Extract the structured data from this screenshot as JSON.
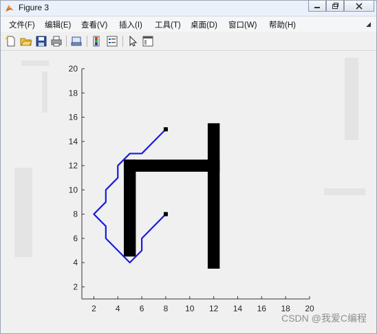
{
  "window": {
    "title": "Figure 3"
  },
  "menu": {
    "items": [
      {
        "label": "文件(F)"
      },
      {
        "label": "编辑(E)"
      },
      {
        "label": "查看(V)"
      },
      {
        "label": "插入(I)"
      },
      {
        "label": "工具(T)"
      },
      {
        "label": "桌面(D)"
      },
      {
        "label": "窗口(W)"
      },
      {
        "label": "帮助(H)"
      }
    ]
  },
  "toolbar": {
    "icons": [
      "new-figure-icon",
      "open-file-icon",
      "save-icon",
      "print-icon",
      "print-preview-icon",
      "insert-colorbar-icon",
      "insert-legend-icon",
      "edit-plot-pointer-icon",
      "property-inspector-icon"
    ]
  },
  "colors": {
    "path_line": "#1a1adc",
    "obstacle": "#000000",
    "axis": "#333333",
    "plot_bg": "#f0f0f0"
  },
  "chart_data": {
    "type": "line",
    "title": "",
    "xlabel": "",
    "ylabel": "",
    "xlim": [
      1,
      20
    ],
    "ylim": [
      1,
      20
    ],
    "xticks": [
      2,
      4,
      6,
      8,
      10,
      12,
      14,
      16,
      18,
      20
    ],
    "yticks": [
      2,
      4,
      6,
      8,
      10,
      12,
      14,
      16,
      18,
      20
    ],
    "grid": false,
    "series": [
      {
        "style": "line",
        "color": "#1a1adc",
        "x": [
          8,
          6,
          5,
          4,
          4,
          3,
          3,
          2,
          3,
          3,
          4,
          5,
          6,
          6,
          8
        ],
        "y": [
          15,
          13,
          13,
          12,
          11,
          10,
          9,
          8,
          7,
          6,
          5,
          4,
          5,
          6,
          8
        ]
      }
    ],
    "endpoints": [
      {
        "x": 8,
        "y": 15
      },
      {
        "x": 8,
        "y": 8
      }
    ],
    "obstacles": [
      {
        "x0": 4.5,
        "x1": 5.5,
        "y0": 4.5,
        "y1": 12.5
      },
      {
        "x0": 4.5,
        "x1": 12.5,
        "y0": 11.5,
        "y1": 12.5
      },
      {
        "x0": 11.5,
        "x1": 12.5,
        "y0": 3.5,
        "y1": 15.5
      }
    ]
  },
  "watermark": {
    "text": "CSDN @我爱C编程"
  }
}
